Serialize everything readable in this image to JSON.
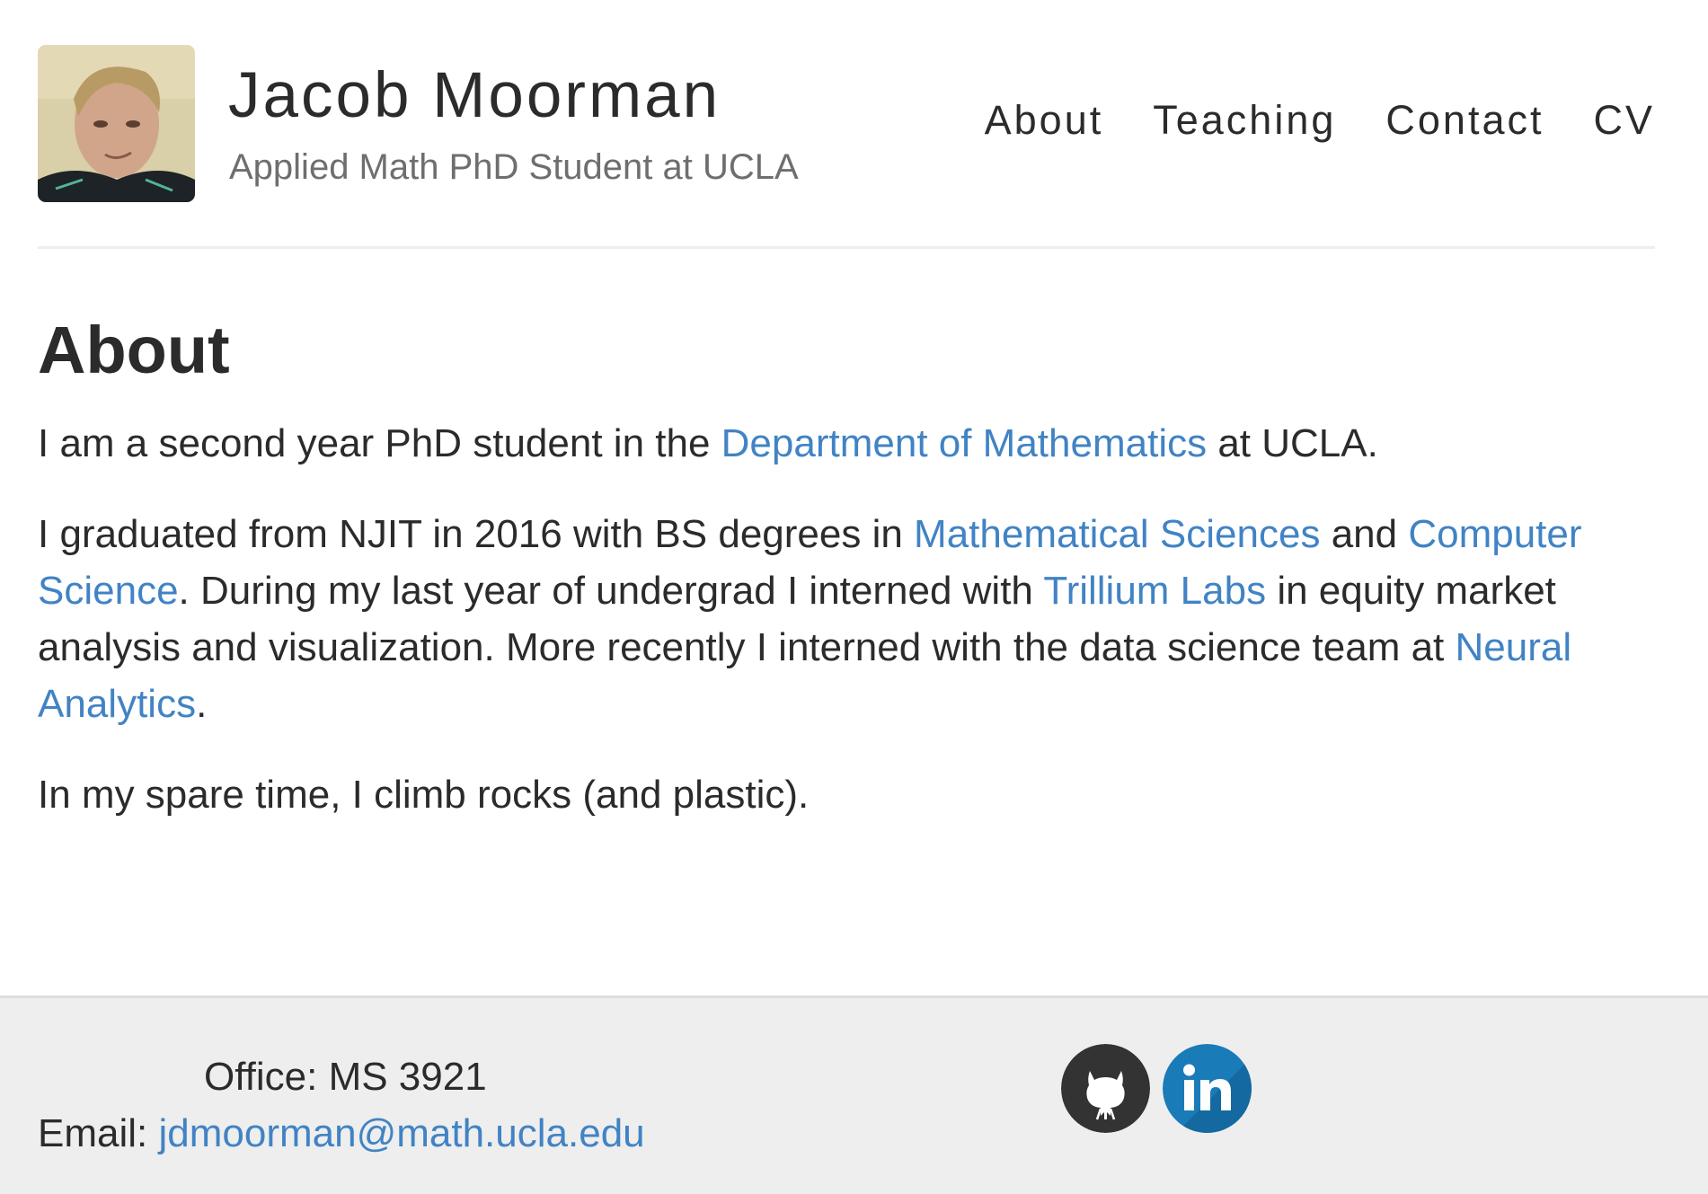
{
  "header": {
    "name": "Jacob Moorman",
    "subtitle": "Applied Math PhD Student at UCLA",
    "nav": [
      "About",
      "Teaching",
      "Contact",
      "CV"
    ]
  },
  "main": {
    "heading": "About",
    "p1": {
      "before": "I am a second year PhD student in the ",
      "link": "Department of Mathematics",
      "after": " at UCLA."
    },
    "p2": {
      "t1": "I graduated from NJIT in 2016 with BS degrees in ",
      "link1": "Mathematical Sciences",
      "t2": " and ",
      "link2": "Computer Science",
      "t3": ". During my last year of undergrad I interned with ",
      "link3": "Trillium Labs",
      "t4": " in equity market analysis and visualization. More recently I interned with the data science team at ",
      "link4": "Neural Analytics",
      "t5": "."
    },
    "p3": "In my spare time, I climb rocks (and plastic)."
  },
  "footer": {
    "office": "Office: MS 3921",
    "email_label": "Email: ",
    "email": "jdmoorman@math.ucla.edu",
    "social": [
      {
        "icon": "github-icon",
        "color": "#333333"
      },
      {
        "icon": "linkedin-icon",
        "color": "#1a7bb9"
      }
    ]
  },
  "colors": {
    "link": "#4183c4",
    "text": "#2b2b2b",
    "footer_bg": "#eeeeee"
  }
}
